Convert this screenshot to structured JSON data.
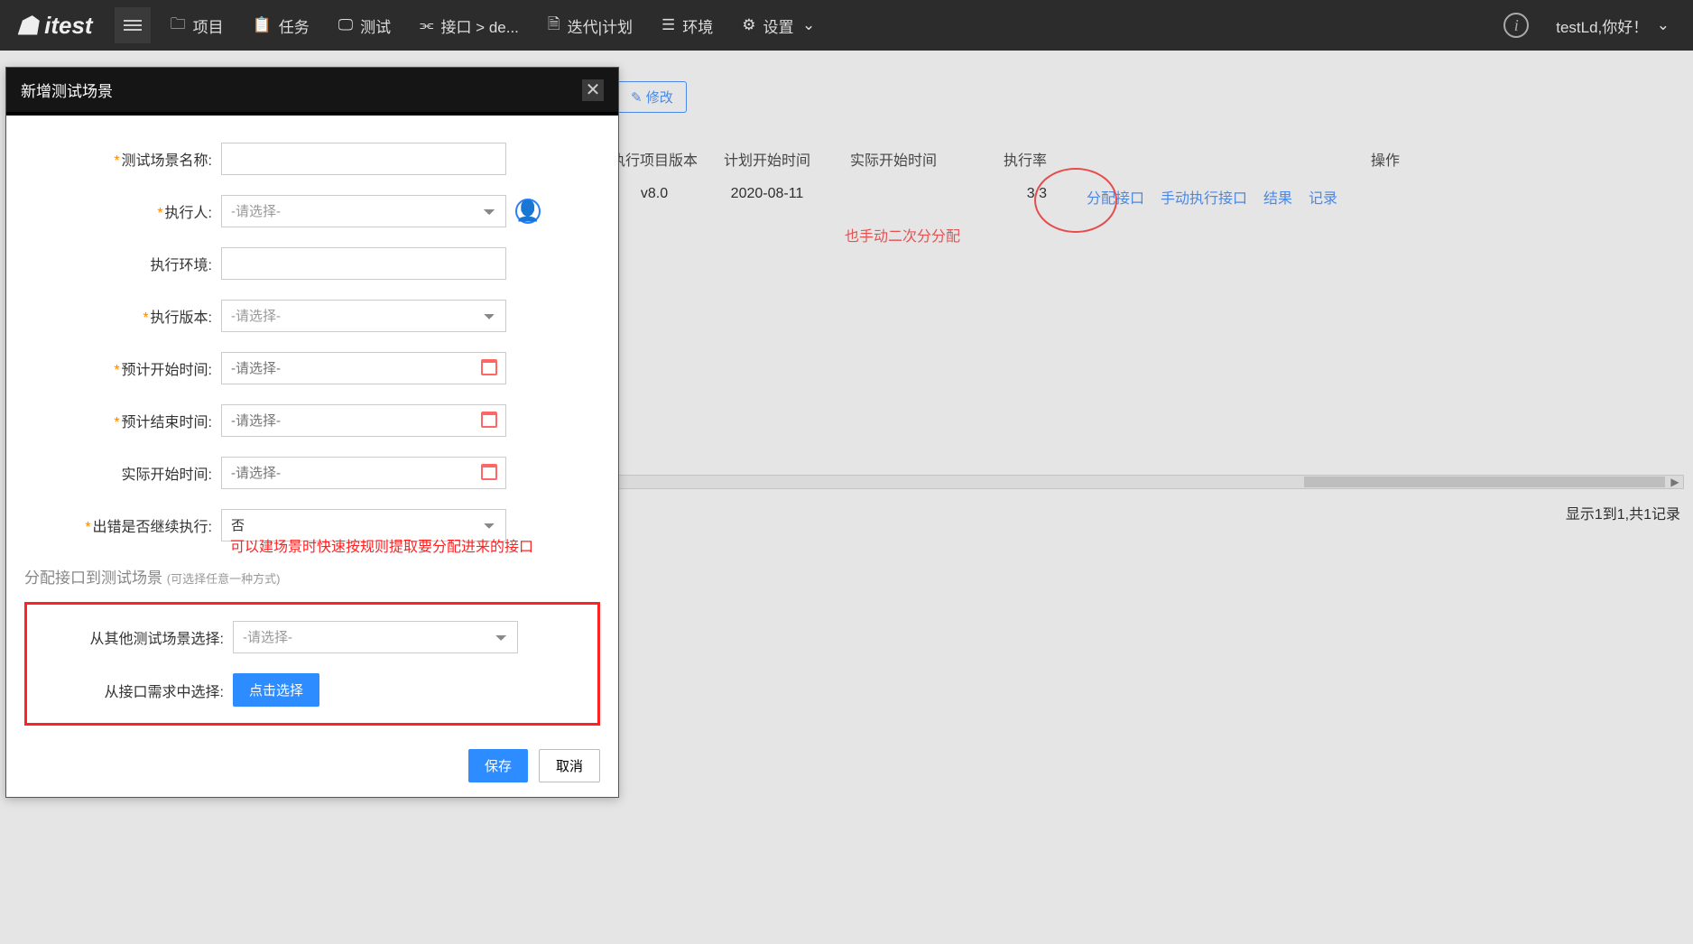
{
  "brand": "itest",
  "nav": {
    "project": "项目",
    "task": "任务",
    "test": "测试",
    "api": "接口 > de...",
    "iteration": "迭代|计划",
    "env": "环境",
    "settings": "设置",
    "user_greeting": "testLd,你好！"
  },
  "page": {
    "modify_btn": "修改",
    "table_headers": {
      "version": "执行项目版本",
      "plan_start": "计划开始时间",
      "actual_start": "实际开始时间",
      "rate": "执行率",
      "ops": "操作"
    },
    "row": {
      "version": "v8.0",
      "plan_start": "2020-08-11",
      "actual_start": "",
      "rate": "3/3",
      "op_assign": "分配接口",
      "op_manual": "手动执行接口",
      "op_result": "结果",
      "op_log": "记录"
    },
    "red_note_table": "也手动二次分分配",
    "record_count": "显示1到1,共1记录"
  },
  "modal": {
    "title": "新增测试场景",
    "labels": {
      "name": "测试场景名称:",
      "executor": "执行人:",
      "env": "执行环境:",
      "version": "执行版本:",
      "plan_start": "预计开始时间:",
      "plan_end": "预计结束时间:",
      "actual_start": "实际开始时间:",
      "continue_on_error": "出错是否继续执行:",
      "from_scene": "从其他测试场景选择:",
      "from_req": "从接口需求中选择:"
    },
    "placeholders": {
      "select": "-请选择-"
    },
    "continue_value": "否",
    "section_title": "分配接口到测试场景",
    "section_hint": "(可选择任意一种方式)",
    "red_note": "可以建场景时快速按规则提取要分配进来的接口",
    "btn_click_select": "点击选择",
    "btn_save": "保存",
    "btn_cancel": "取消"
  }
}
